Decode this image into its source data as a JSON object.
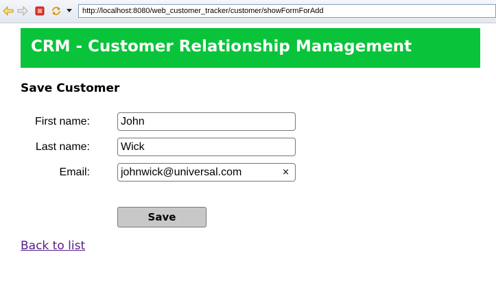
{
  "browser": {
    "url": "http://localhost:8080/web_customer_tracker/customer/showFormForAdd",
    "icons": [
      "back-arrow-icon",
      "forward-arrow-icon",
      "stop-icon",
      "reload-icon",
      "dropdown-arrow-icon"
    ]
  },
  "header": {
    "title": "CRM - Customer Relationship Management",
    "background_color": "#09c43a"
  },
  "page": {
    "heading": "Save Customer"
  },
  "form": {
    "first_name_label": "First name:",
    "first_name_value": "John",
    "last_name_label": "Last name:",
    "last_name_value": "Wick",
    "email_label": "Email:",
    "email_value": "johnwick@universal.com",
    "clear_glyph": "×",
    "save_label": "Save"
  },
  "links": {
    "back": "Back to list",
    "visited_color": "#551a8b"
  }
}
